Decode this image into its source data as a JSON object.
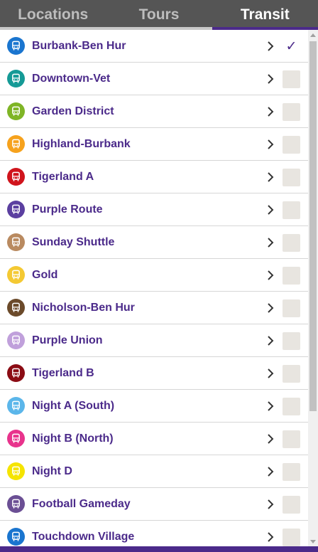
{
  "tabs": [
    {
      "label": "Locations",
      "active": false
    },
    {
      "label": "Tours",
      "active": false
    },
    {
      "label": "Transit",
      "active": true
    }
  ],
  "routes": [
    {
      "name": "Burbank-Ben Hur",
      "color": "#1a75cf",
      "checked": true
    },
    {
      "name": "Downtown-Vet",
      "color": "#159a96",
      "checked": false
    },
    {
      "name": "Garden District",
      "color": "#7fb526",
      "checked": false
    },
    {
      "name": "Highland-Burbank",
      "color": "#f6a21d",
      "checked": false
    },
    {
      "name": "Tigerland A",
      "color": "#d0141c",
      "checked": false
    },
    {
      "name": "Purple Route",
      "color": "#5b3fa0",
      "checked": false
    },
    {
      "name": "Sunday Shuttle",
      "color": "#b98a60",
      "checked": false
    },
    {
      "name": "Gold",
      "color": "#f4c933",
      "checked": false
    },
    {
      "name": "Nicholson-Ben Hur",
      "color": "#6b4a2a",
      "checked": false
    },
    {
      "name": "Purple Union",
      "color": "#c0a0db",
      "checked": false
    },
    {
      "name": "Tigerland B",
      "color": "#8b0c14",
      "checked": false
    },
    {
      "name": "Night A (South)",
      "color": "#5bb6ea",
      "checked": false
    },
    {
      "name": "Night B (North)",
      "color": "#e8338c",
      "checked": false
    },
    {
      "name": "Night D",
      "color": "#f5e400",
      "checked": false
    },
    {
      "name": "Football Gameday",
      "color": "#6b4f94",
      "checked": false
    },
    {
      "name": "Touchdown Village",
      "color": "#1a75cf",
      "checked": false
    }
  ],
  "check_glyph": "✓",
  "icon_name": "bus-icon",
  "accent_color": "#4b2a8a"
}
